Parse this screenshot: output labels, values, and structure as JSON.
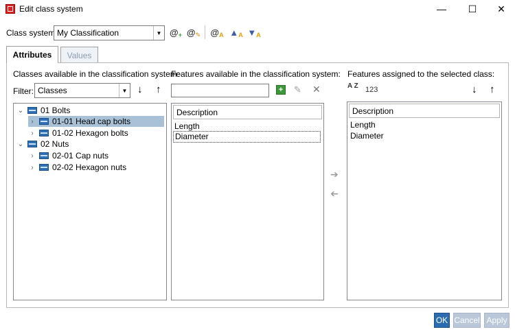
{
  "window": {
    "title": "Edit class system",
    "minimize": "—",
    "maximize": "☐",
    "close": "✕"
  },
  "toolbar": {
    "class_system_label": "Class system:",
    "class_system_value": "My Classification"
  },
  "tabs": [
    {
      "label": "Attributes",
      "active": true
    },
    {
      "label": "Values",
      "active": false
    }
  ],
  "classes_panel": {
    "header": "Classes available in the classification system:",
    "filter_label": "Filter:",
    "filter_value": "Classes",
    "tree": [
      {
        "label": "01 Bolts",
        "expander": "⌄"
      },
      {
        "label": "01-01 Head cap bolts",
        "expander": "›",
        "selected": true
      },
      {
        "label": "01-02 Hexagon bolts",
        "expander": "›"
      },
      {
        "label": "02 Nuts",
        "expander": "⌄"
      },
      {
        "label": "02-01 Cap nuts",
        "expander": "›"
      },
      {
        "label": "02-02 Hexagon nuts",
        "expander": "›"
      }
    ]
  },
  "features_available": {
    "header": "Features available in the classification system:",
    "search_value": "",
    "column": "Description",
    "rows": [
      "Length",
      "Diameter"
    ]
  },
  "features_assigned": {
    "header": "Features assigned to the selected class:",
    "sort_alpha": "A Z",
    "sort_num": "123",
    "column": "Description",
    "rows": [
      "Length",
      "Diameter"
    ]
  },
  "footer": {
    "ok": "OK",
    "cancel": "Cancel",
    "apply": "Apply"
  },
  "colors": {
    "accent": "#2b6cb0",
    "selection": "#a9c1d6",
    "add_green": "#3a9a3a"
  }
}
